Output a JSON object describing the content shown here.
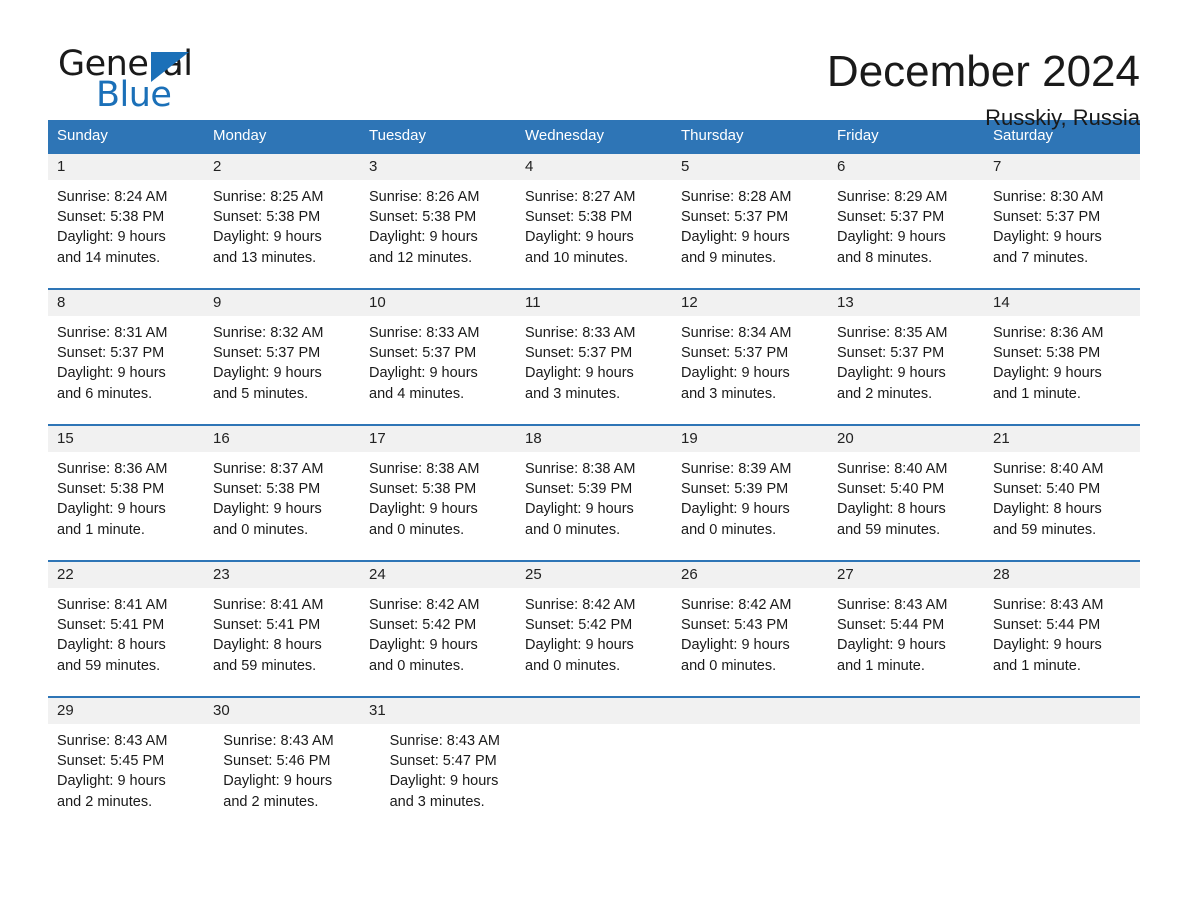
{
  "brand": {
    "word_one": "General",
    "word_two": "Blue",
    "triangle_color": "#1b70b8"
  },
  "header": {
    "month_title": "December 2024",
    "location": "Russkiy, Russia"
  },
  "theme": {
    "header_blue": "#2e75b6",
    "date_band": "#f1f1f1",
    "text": "#1a1a1a"
  },
  "calendar": {
    "day_names": [
      "Sunday",
      "Monday",
      "Tuesday",
      "Wednesday",
      "Thursday",
      "Friday",
      "Saturday"
    ],
    "weeks": [
      {
        "days": [
          {
            "date": "1",
            "sunrise": "Sunrise: 8:24 AM",
            "sunset": "Sunset: 5:38 PM",
            "daylight_1": "Daylight: 9 hours",
            "daylight_2": "and 14 minutes."
          },
          {
            "date": "2",
            "sunrise": "Sunrise: 8:25 AM",
            "sunset": "Sunset: 5:38 PM",
            "daylight_1": "Daylight: 9 hours",
            "daylight_2": "and 13 minutes."
          },
          {
            "date": "3",
            "sunrise": "Sunrise: 8:26 AM",
            "sunset": "Sunset: 5:38 PM",
            "daylight_1": "Daylight: 9 hours",
            "daylight_2": "and 12 minutes."
          },
          {
            "date": "4",
            "sunrise": "Sunrise: 8:27 AM",
            "sunset": "Sunset: 5:38 PM",
            "daylight_1": "Daylight: 9 hours",
            "daylight_2": "and 10 minutes."
          },
          {
            "date": "5",
            "sunrise": "Sunrise: 8:28 AM",
            "sunset": "Sunset: 5:37 PM",
            "daylight_1": "Daylight: 9 hours",
            "daylight_2": "and 9 minutes."
          },
          {
            "date": "6",
            "sunrise": "Sunrise: 8:29 AM",
            "sunset": "Sunset: 5:37 PM",
            "daylight_1": "Daylight: 9 hours",
            "daylight_2": "and 8 minutes."
          },
          {
            "date": "7",
            "sunrise": "Sunrise: 8:30 AM",
            "sunset": "Sunset: 5:37 PM",
            "daylight_1": "Daylight: 9 hours",
            "daylight_2": "and 7 minutes."
          }
        ]
      },
      {
        "days": [
          {
            "date": "8",
            "sunrise": "Sunrise: 8:31 AM",
            "sunset": "Sunset: 5:37 PM",
            "daylight_1": "Daylight: 9 hours",
            "daylight_2": "and 6 minutes."
          },
          {
            "date": "9",
            "sunrise": "Sunrise: 8:32 AM",
            "sunset": "Sunset: 5:37 PM",
            "daylight_1": "Daylight: 9 hours",
            "daylight_2": "and 5 minutes."
          },
          {
            "date": "10",
            "sunrise": "Sunrise: 8:33 AM",
            "sunset": "Sunset: 5:37 PM",
            "daylight_1": "Daylight: 9 hours",
            "daylight_2": "and 4 minutes."
          },
          {
            "date": "11",
            "sunrise": "Sunrise: 8:33 AM",
            "sunset": "Sunset: 5:37 PM",
            "daylight_1": "Daylight: 9 hours",
            "daylight_2": "and 3 minutes."
          },
          {
            "date": "12",
            "sunrise": "Sunrise: 8:34 AM",
            "sunset": "Sunset: 5:37 PM",
            "daylight_1": "Daylight: 9 hours",
            "daylight_2": "and 3 minutes."
          },
          {
            "date": "13",
            "sunrise": "Sunrise: 8:35 AM",
            "sunset": "Sunset: 5:37 PM",
            "daylight_1": "Daylight: 9 hours",
            "daylight_2": "and 2 minutes."
          },
          {
            "date": "14",
            "sunrise": "Sunrise: 8:36 AM",
            "sunset": "Sunset: 5:38 PM",
            "daylight_1": "Daylight: 9 hours",
            "daylight_2": "and 1 minute."
          }
        ]
      },
      {
        "days": [
          {
            "date": "15",
            "sunrise": "Sunrise: 8:36 AM",
            "sunset": "Sunset: 5:38 PM",
            "daylight_1": "Daylight: 9 hours",
            "daylight_2": "and 1 minute."
          },
          {
            "date": "16",
            "sunrise": "Sunrise: 8:37 AM",
            "sunset": "Sunset: 5:38 PM",
            "daylight_1": "Daylight: 9 hours",
            "daylight_2": "and 0 minutes."
          },
          {
            "date": "17",
            "sunrise": "Sunrise: 8:38 AM",
            "sunset": "Sunset: 5:38 PM",
            "daylight_1": "Daylight: 9 hours",
            "daylight_2": "and 0 minutes."
          },
          {
            "date": "18",
            "sunrise": "Sunrise: 8:38 AM",
            "sunset": "Sunset: 5:39 PM",
            "daylight_1": "Daylight: 9 hours",
            "daylight_2": "and 0 minutes."
          },
          {
            "date": "19",
            "sunrise": "Sunrise: 8:39 AM",
            "sunset": "Sunset: 5:39 PM",
            "daylight_1": "Daylight: 9 hours",
            "daylight_2": "and 0 minutes."
          },
          {
            "date": "20",
            "sunrise": "Sunrise: 8:40 AM",
            "sunset": "Sunset: 5:40 PM",
            "daylight_1": "Daylight: 8 hours",
            "daylight_2": "and 59 minutes."
          },
          {
            "date": "21",
            "sunrise": "Sunrise: 8:40 AM",
            "sunset": "Sunset: 5:40 PM",
            "daylight_1": "Daylight: 8 hours",
            "daylight_2": "and 59 minutes."
          }
        ]
      },
      {
        "days": [
          {
            "date": "22",
            "sunrise": "Sunrise: 8:41 AM",
            "sunset": "Sunset: 5:41 PM",
            "daylight_1": "Daylight: 8 hours",
            "daylight_2": "and 59 minutes."
          },
          {
            "date": "23",
            "sunrise": "Sunrise: 8:41 AM",
            "sunset": "Sunset: 5:41 PM",
            "daylight_1": "Daylight: 8 hours",
            "daylight_2": "and 59 minutes."
          },
          {
            "date": "24",
            "sunrise": "Sunrise: 8:42 AM",
            "sunset": "Sunset: 5:42 PM",
            "daylight_1": "Daylight: 9 hours",
            "daylight_2": "and 0 minutes."
          },
          {
            "date": "25",
            "sunrise": "Sunrise: 8:42 AM",
            "sunset": "Sunset: 5:42 PM",
            "daylight_1": "Daylight: 9 hours",
            "daylight_2": "and 0 minutes."
          },
          {
            "date": "26",
            "sunrise": "Sunrise: 8:42 AM",
            "sunset": "Sunset: 5:43 PM",
            "daylight_1": "Daylight: 9 hours",
            "daylight_2": "and 0 minutes."
          },
          {
            "date": "27",
            "sunrise": "Sunrise: 8:43 AM",
            "sunset": "Sunset: 5:44 PM",
            "daylight_1": "Daylight: 9 hours",
            "daylight_2": "and 1 minute."
          },
          {
            "date": "28",
            "sunrise": "Sunrise: 8:43 AM",
            "sunset": "Sunset: 5:44 PM",
            "daylight_1": "Daylight: 9 hours",
            "daylight_2": "and 1 minute."
          }
        ]
      },
      {
        "days": [
          {
            "date": "29",
            "sunrise": "Sunrise: 8:43 AM",
            "sunset": "Sunset: 5:45 PM",
            "daylight_1": "Daylight: 9 hours",
            "daylight_2": "and 2 minutes."
          },
          {
            "date": "30",
            "sunrise": "Sunrise: 8:43 AM",
            "sunset": "Sunset: 5:46 PM",
            "daylight_1": "Daylight: 9 hours",
            "daylight_2": "and 2 minutes."
          },
          {
            "date": "31",
            "sunrise": "Sunrise: 8:43 AM",
            "sunset": "Sunset: 5:47 PM",
            "daylight_1": "Daylight: 9 hours",
            "daylight_2": "and 3 minutes."
          },
          {
            "date": "",
            "sunrise": "",
            "sunset": "",
            "daylight_1": "",
            "daylight_2": ""
          },
          {
            "date": "",
            "sunrise": "",
            "sunset": "",
            "daylight_1": "",
            "daylight_2": ""
          },
          {
            "date": "",
            "sunrise": "",
            "sunset": "",
            "daylight_1": "",
            "daylight_2": ""
          },
          {
            "date": "",
            "sunrise": "",
            "sunset": "",
            "daylight_1": "",
            "daylight_2": ""
          }
        ]
      }
    ]
  }
}
